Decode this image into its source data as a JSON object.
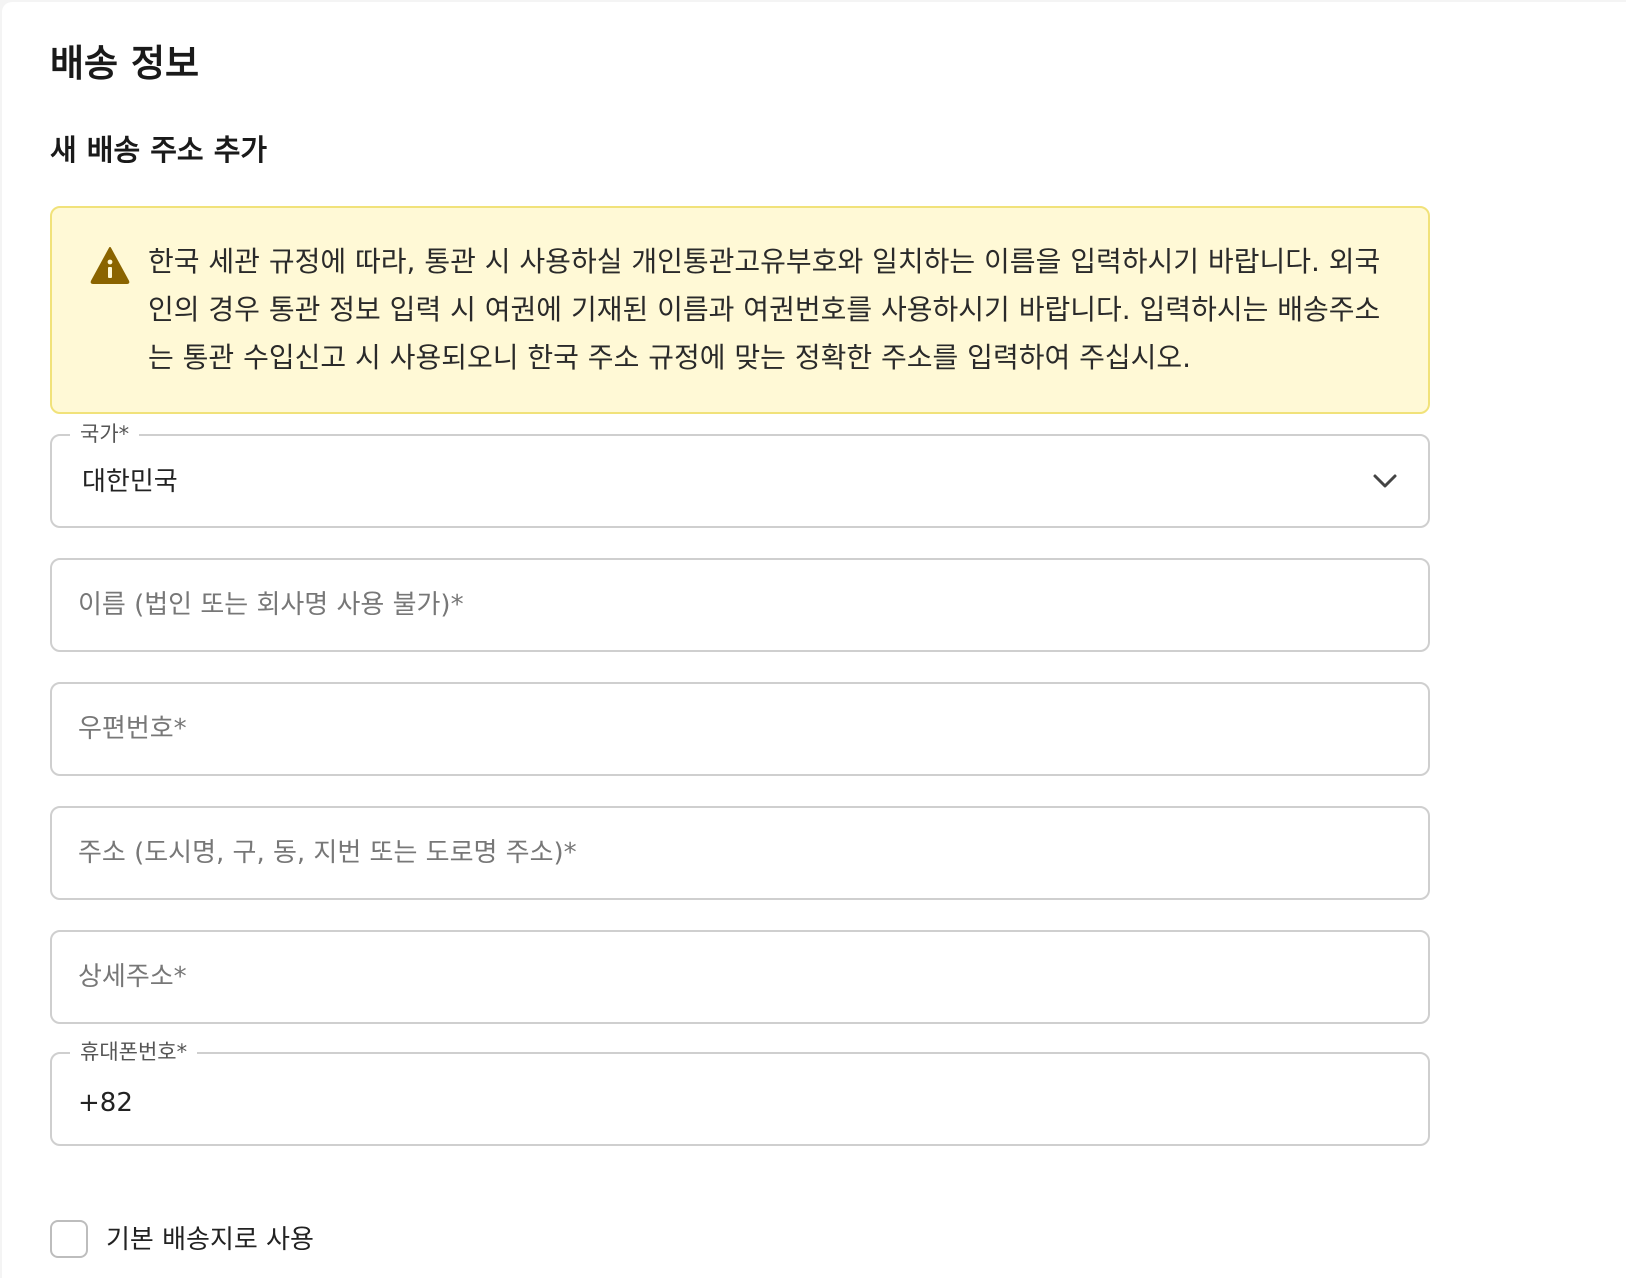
{
  "page": {
    "title": "배송 정보",
    "section_title": "새 배송 주소 추가"
  },
  "notice": {
    "icon": "warning-triangle-icon",
    "text": "한국 세관 규정에 따라, 통관 시 사용하실 개인통관고유부호와 일치하는 이름을 입력하시기 바랍니다. 외국인의 경우 통관 정보 입력 시 여권에 기재된 이름과 여권번호를 사용하시기 바랍니다. 입력하시는 배송주소는 통관 수입신고 시 사용되오니 한국 주소 규정에 맞는 정확한 주소를 입력하여 주십시오.",
    "background_color": "#fff9d6",
    "border_color": "#f1e27a",
    "icon_color": "#8a6400"
  },
  "form": {
    "country": {
      "label": "국가*",
      "value": "대한민국"
    },
    "name": {
      "placeholder": "이름 (법인 또는 회사명 사용 불가)*",
      "value": ""
    },
    "postal_code": {
      "placeholder": "우편번호*",
      "value": ""
    },
    "address": {
      "placeholder": "주소 (도시명, 구, 동, 지번 또는 도로명 주소)*",
      "value": ""
    },
    "address_detail": {
      "placeholder": "상세주소*",
      "value": ""
    },
    "phone": {
      "label": "휴대폰번호*",
      "value": "+82"
    },
    "default_address": {
      "label": "기본 배송지로 사용",
      "checked": false
    }
  }
}
